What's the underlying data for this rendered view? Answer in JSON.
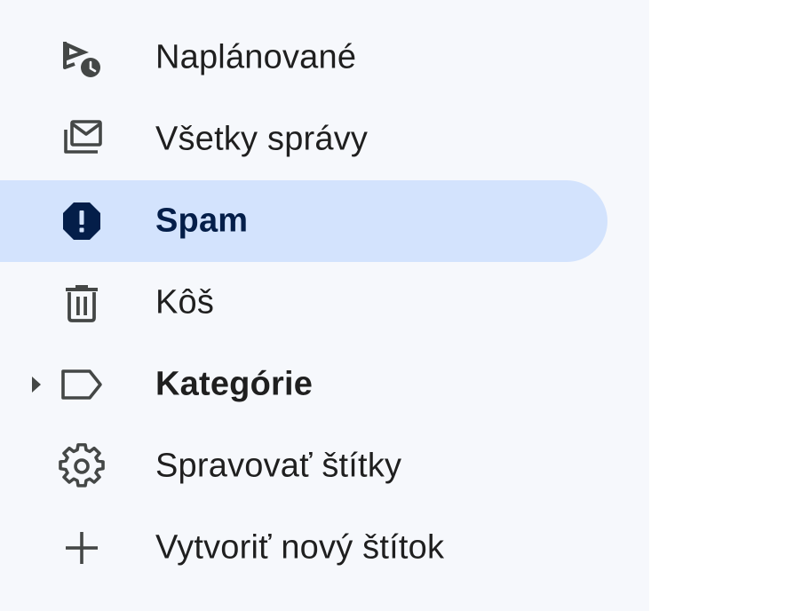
{
  "sidebar": {
    "items": [
      {
        "label": "Naplánované",
        "icon": "scheduled-send-icon"
      },
      {
        "label": "Všetky správy",
        "icon": "all-mail-icon"
      },
      {
        "label": "Spam",
        "icon": "spam-icon",
        "active": true
      },
      {
        "label": "Kôš",
        "icon": "trash-icon"
      },
      {
        "label": "Kategórie",
        "icon": "label-icon",
        "expandable": true
      },
      {
        "label": "Spravovať štítky",
        "icon": "gear-icon"
      },
      {
        "label": "Vytvoriť nový štítok",
        "icon": "plus-icon"
      }
    ]
  },
  "colors": {
    "sidebar_bg": "#f6f8fc",
    "active_bg": "#d3e3fd",
    "active_text": "#041e49",
    "icon": "#444746"
  }
}
